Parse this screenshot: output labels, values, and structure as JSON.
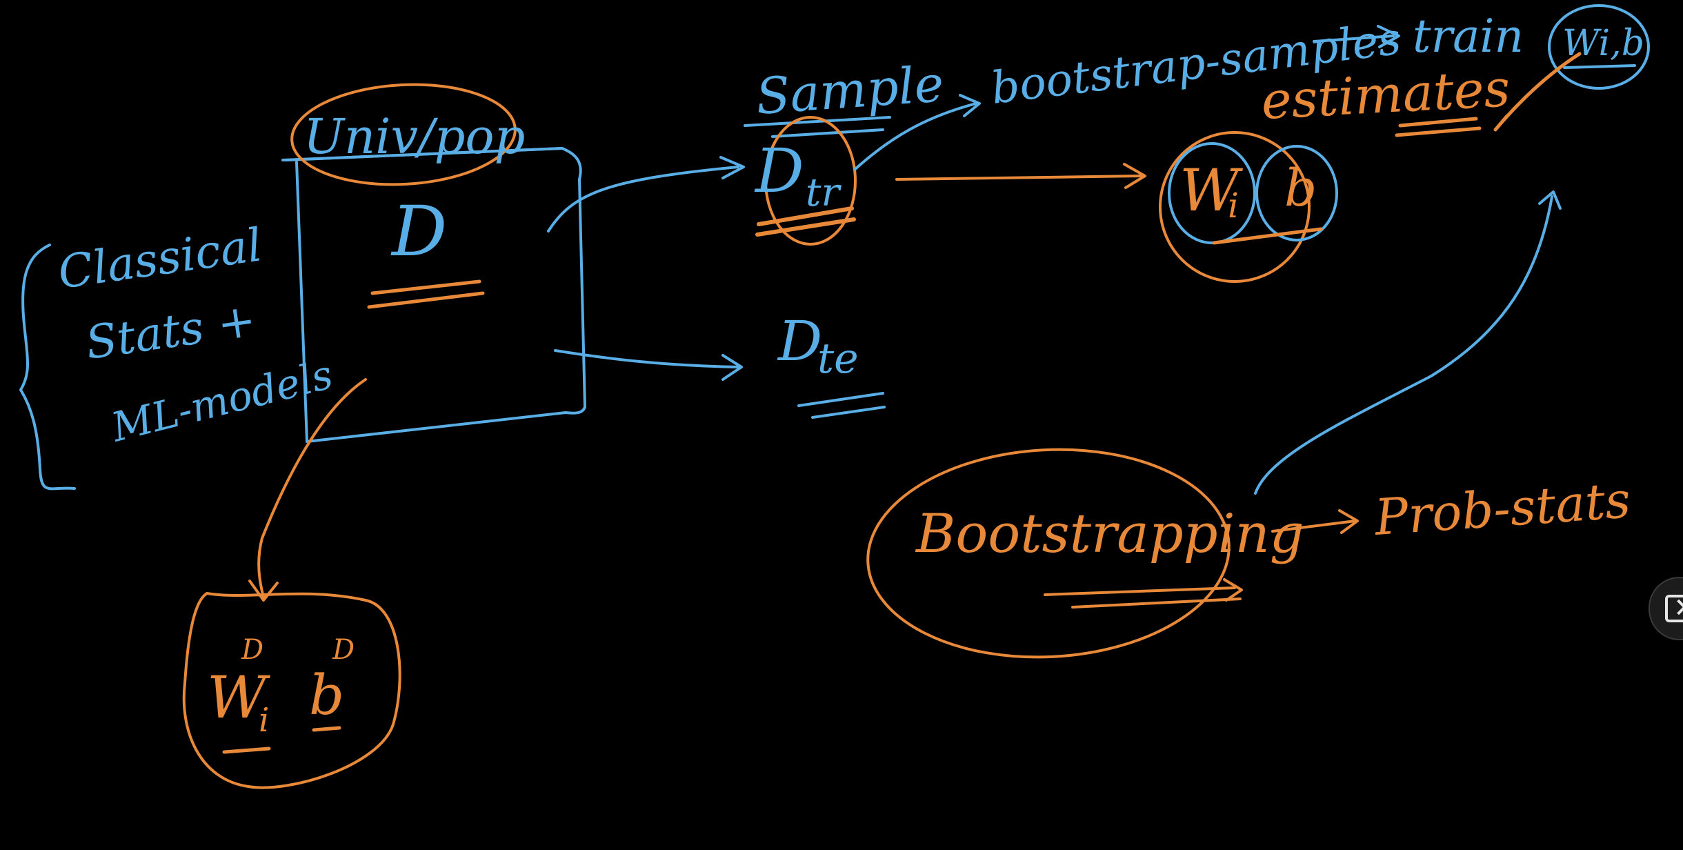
{
  "colors": {
    "background": "#000000",
    "blue": "#5aaee6",
    "orange": "#e8893a"
  },
  "labels": {
    "classical_line1": "Classical",
    "classical_line2": "Stats +",
    "classical_line3": "ML-models",
    "univ_pop": "Univ/pop",
    "dataset": "D",
    "sample": "Sample",
    "d_tr_base": "D",
    "d_tr_sub": "tr",
    "bootstrap_samples": "bootstrap-samples",
    "train": "train",
    "wib_top": "Wi,b",
    "estimates": "estimates",
    "wi_base": "W",
    "wi_sub": "i",
    "b_inner": "b",
    "d_te_base": "D",
    "d_te_sub": "te",
    "bootstrapping": "Bootstrapping",
    "prob_stats": "Prob-stats",
    "wd_base": "W",
    "wd_sub": "i",
    "wd_sup": "D",
    "bd_base": "b",
    "bd_sup": "D"
  },
  "icons": {
    "side_button": "expand-panel-icon"
  }
}
